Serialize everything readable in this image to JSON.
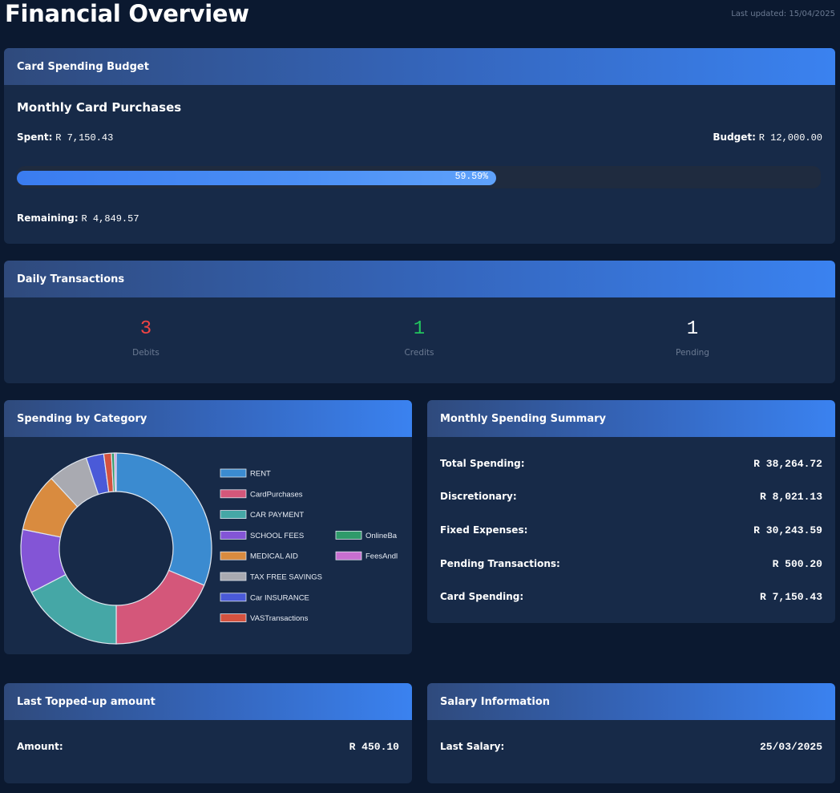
{
  "page": {
    "title": "Financial Overview",
    "last_updated": "Last updated: 15/04/2025"
  },
  "budget": {
    "header": "Card Spending Budget",
    "subtitle": "Monthly Card Purchases",
    "spent_label": "Spent:",
    "spent_value": "R 7,150.43",
    "budget_label": "Budget:",
    "budget_value": "R 12,000.00",
    "progress_percent": 59.59,
    "progress_text": "59.59%",
    "remaining_label": "Remaining:",
    "remaining_value": "R 4,849.57",
    "accent": "#3b82f6"
  },
  "daily": {
    "header": "Daily Transactions",
    "debits": {
      "value": "3",
      "label": "Debits",
      "color": "#ef4444"
    },
    "credits": {
      "value": "1",
      "label": "Credits",
      "color": "#22c55e"
    },
    "pending": {
      "value": "1",
      "label": "Pending",
      "color": "#ffffff"
    }
  },
  "category": {
    "header": "Spending by Category",
    "chart_data": {
      "type": "pie",
      "categories": [
        "RENT",
        "CardPurchases",
        "CAR PAYMENT",
        "SCHOOL FEES",
        "MEDICAL AID",
        "TAX FREE SAVINGS",
        "Car INSURANCE",
        "VASTransactions",
        "OnlineBa",
        "FeesAndl"
      ],
      "values": [
        31.3,
        18.7,
        17.4,
        10.8,
        9.9,
        6.8,
        3.0,
        1.3,
        0.5,
        0.3
      ],
      "colors": [
        "#3b8bd0",
        "#d4577a",
        "#45a7a6",
        "#8355d6",
        "#d98b3f",
        "#a9aab1",
        "#4a5ad8",
        "#d4523f",
        "#2f9a6a",
        "#c86fd0"
      ]
    }
  },
  "summary": {
    "header": "Monthly Spending Summary",
    "rows": [
      {
        "label": "Total Spending:",
        "value": "R 38,264.72"
      },
      {
        "label": "Discretionary:",
        "value": "R 8,021.13"
      },
      {
        "label": "Fixed Expenses:",
        "value": "R 30,243.59"
      },
      {
        "label": "Pending Transactions:",
        "value": "R 500.20"
      },
      {
        "label": "Card Spending:",
        "value": "R 7,150.43"
      }
    ]
  },
  "topup": {
    "header": "Last Topped-up amount",
    "label": "Amount:",
    "value": "R 450.10"
  },
  "salary": {
    "header": "Salary Information",
    "label": "Last Salary:",
    "value": "25/03/2025"
  }
}
